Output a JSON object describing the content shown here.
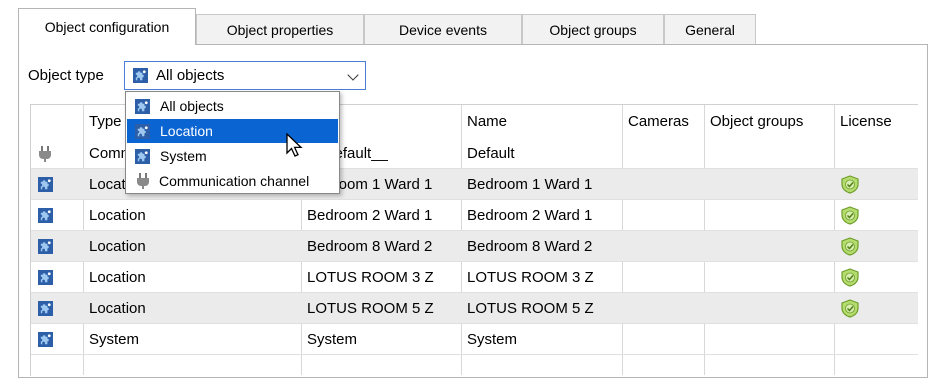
{
  "tabs": [
    {
      "label": "Object configuration",
      "active": true
    },
    {
      "label": "Object properties",
      "active": false
    },
    {
      "label": "Device events",
      "active": false
    },
    {
      "label": "Object groups",
      "active": false
    },
    {
      "label": "General",
      "active": false
    }
  ],
  "object_type": {
    "label": "Object type",
    "selected": "All objects",
    "icon": "puzzle-icon",
    "options": [
      {
        "label": "All objects",
        "icon": "puzzle-icon",
        "highlighted": false
      },
      {
        "label": "Location",
        "icon": "puzzle-icon",
        "highlighted": true
      },
      {
        "label": "System",
        "icon": "puzzle-icon",
        "highlighted": false
      },
      {
        "label": "Communication channel",
        "icon": "plug-icon",
        "highlighted": false
      }
    ]
  },
  "table": {
    "columns": [
      "",
      "Type",
      "",
      "Name",
      "Cameras",
      "Object groups",
      "License"
    ],
    "rows": [
      {
        "icon": "plug-icon",
        "type": "Communication channel",
        "id": "__Default__",
        "name": "Default",
        "license": false,
        "shaded": false
      },
      {
        "icon": "puzzle-icon",
        "type": "Location",
        "id": "Bedroom 1 Ward 1",
        "name": "Bedroom 1 Ward 1",
        "license": true,
        "shaded": true
      },
      {
        "icon": "puzzle-icon",
        "type": "Location",
        "id": "Bedroom 2 Ward 1",
        "name": "Bedroom 2 Ward 1",
        "license": true,
        "shaded": false
      },
      {
        "icon": "puzzle-icon",
        "type": "Location",
        "id": "Bedroom 8 Ward 2",
        "name": "Bedroom 8 Ward 2",
        "license": true,
        "shaded": true
      },
      {
        "icon": "puzzle-icon",
        "type": "Location",
        "id": "LOTUS ROOM 3 Z",
        "name": "LOTUS ROOM 3 Z",
        "license": true,
        "shaded": false
      },
      {
        "icon": "puzzle-icon",
        "type": "Location",
        "id": "LOTUS ROOM 5 Z",
        "name": "LOTUS ROOM 5 Z",
        "license": true,
        "shaded": true
      },
      {
        "icon": "puzzle-icon",
        "type": "System",
        "id": "System",
        "name": "System",
        "license": false,
        "shaded": false
      }
    ]
  },
  "colors": {
    "selection": "#0a64d2",
    "shaded_row": "#ebebeb",
    "focus_border": "#4a7ed6",
    "license_shield": "#8cc63f"
  }
}
